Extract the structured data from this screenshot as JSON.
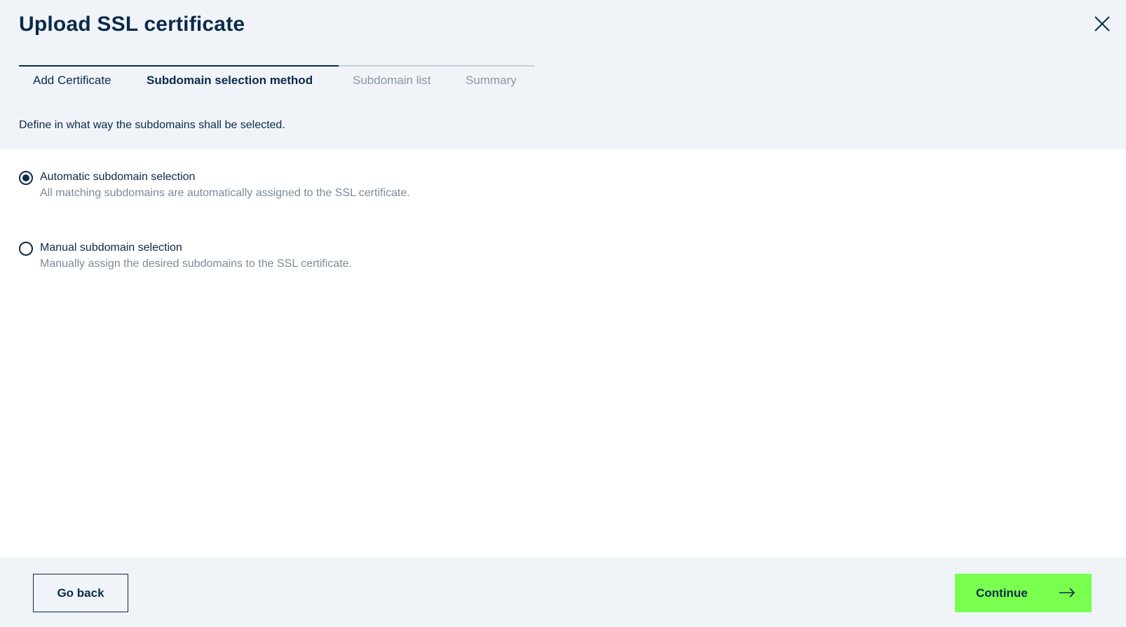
{
  "dialog": {
    "title": "Upload SSL certificate",
    "close_icon": "close-icon"
  },
  "stepper": {
    "steps": [
      {
        "label": "Add Certificate",
        "state": "done"
      },
      {
        "label": "Subdomain selection method",
        "state": "active"
      },
      {
        "label": "Subdomain list",
        "state": "pending"
      },
      {
        "label": "Summary",
        "state": "pending"
      }
    ],
    "current_step": 2
  },
  "intro": "Define in what way the subdomains shall be selected.",
  "options": [
    {
      "label": "Automatic subdomain selection",
      "description": "All matching subdomains are automatically assigned to the SSL certificate.",
      "selected": true
    },
    {
      "label": "Manual subdomain selection",
      "description": "Manually assign the desired subdomains to the SSL certificate.",
      "selected": false
    }
  ],
  "footer": {
    "back_label": "Go back",
    "continue_label": "Continue",
    "continue_icon": "arrow-right-icon"
  },
  "colors": {
    "primary_text": "#0b2a4a",
    "muted_text": "#7c8a99",
    "header_bg": "#f0f4f9",
    "accent": "#79ff4e"
  }
}
